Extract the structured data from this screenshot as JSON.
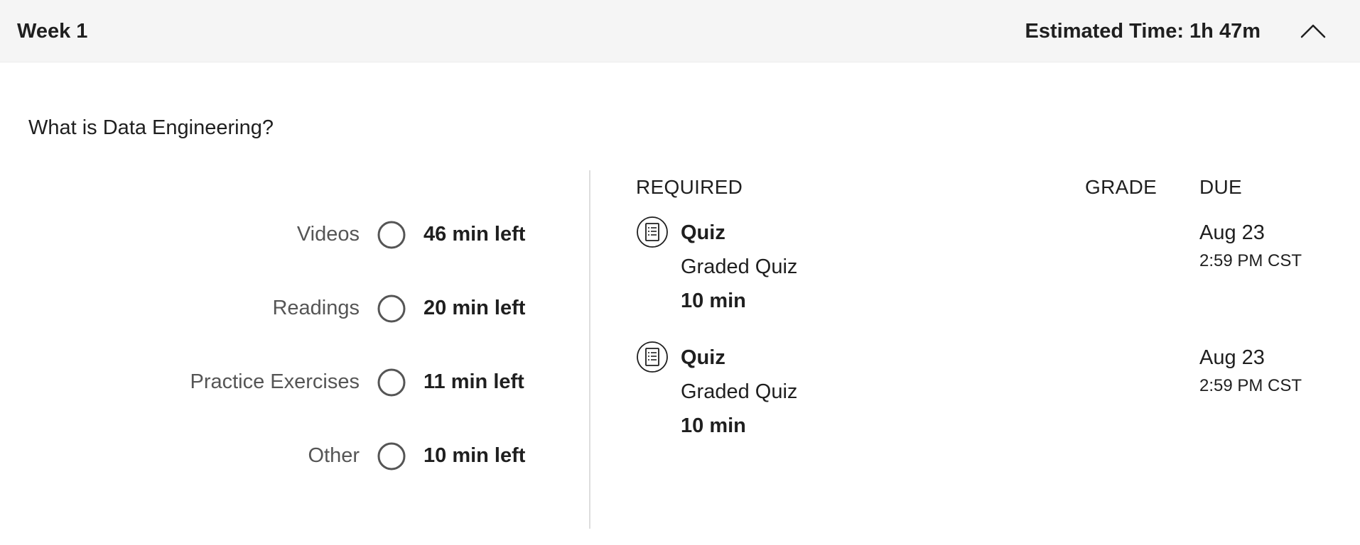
{
  "header": {
    "week_title": "Week 1",
    "estimated_time": "Estimated Time: 1h 47m",
    "collapse_icon": "chevron-up-icon"
  },
  "module": {
    "title": "What is Data Engineering?"
  },
  "progress": [
    {
      "label": "Videos",
      "time_left": "46 min left"
    },
    {
      "label": "Readings",
      "time_left": "20 min left"
    },
    {
      "label": "Practice Exercises",
      "time_left": "11 min left"
    },
    {
      "label": "Other",
      "time_left": "10 min left"
    }
  ],
  "table": {
    "headers": {
      "required": "REQUIRED",
      "grade": "GRADE",
      "due": "DUE"
    },
    "items": [
      {
        "icon": "quiz-icon",
        "title": "Quiz",
        "type": "Graded Quiz",
        "duration": "10 min",
        "due_date": "Aug 23",
        "due_time": "2:59 PM CST"
      },
      {
        "icon": "quiz-icon",
        "title": "Quiz",
        "type": "Graded Quiz",
        "duration": "10 min",
        "due_date": "Aug 23",
        "due_time": "2:59 PM CST"
      }
    ]
  },
  "colors": {
    "header_bg": "#f5f5f5",
    "text": "#1f1f1f",
    "muted_text": "#555555",
    "ring": "#555555",
    "divider": "#dddddd"
  }
}
